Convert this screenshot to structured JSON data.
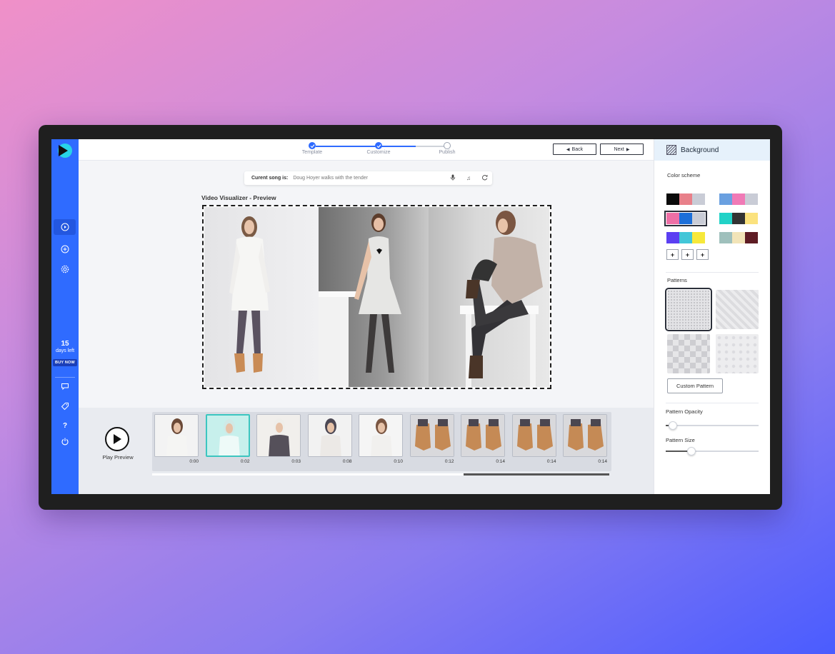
{
  "steps": [
    {
      "label": "Template",
      "state": "done"
    },
    {
      "label": "Customize",
      "state": "done"
    },
    {
      "label": "Publish",
      "state": "todo"
    }
  ],
  "nav": {
    "back": "Back",
    "next": "Next"
  },
  "song": {
    "label": "Curent song is:",
    "value": "Doug Hoyer walks with the tender"
  },
  "preview": {
    "title": "Video Visualizer - Preview"
  },
  "trial": {
    "days": "15",
    "days_label": "days left",
    "buy": "BUY NOW"
  },
  "timeline": {
    "play_label": "Play Preview",
    "thumbs": [
      {
        "time": "0:00"
      },
      {
        "time": "0:02"
      },
      {
        "time": "0:03"
      },
      {
        "time": "0:08"
      },
      {
        "time": "0:10"
      },
      {
        "time": "0:12"
      },
      {
        "time": "0:14"
      },
      {
        "time": "0:14"
      },
      {
        "time": "0:14"
      }
    ],
    "selected_index": 1
  },
  "panel": {
    "title": "Background",
    "color_scheme_label": "Color scheme",
    "patterns_label": "Patterns",
    "custom_pattern": "Custom Pattern",
    "opacity_label": "Pattern Opacity",
    "size_label": "Pattern Size",
    "opacity_value": 0.08,
    "size_value": 0.28,
    "color_schemes": [
      [
        "#0b0b0b",
        "#e8808a",
        "#c9ccd6"
      ],
      [
        "#6aa0e0",
        "#f07ab6",
        "#c9ccd6"
      ],
      [
        "#ee6fa6",
        "#1c6fd9",
        "#c9ccd6"
      ],
      [
        "#21d2c7",
        "#333333",
        "#fbe27e"
      ],
      [
        "#5b3ff2",
        "#42c6d8",
        "#f6e83a"
      ],
      [
        "#9fc0bc",
        "#f2e4b8",
        "#5e1c24"
      ]
    ],
    "plus_label": "+"
  }
}
